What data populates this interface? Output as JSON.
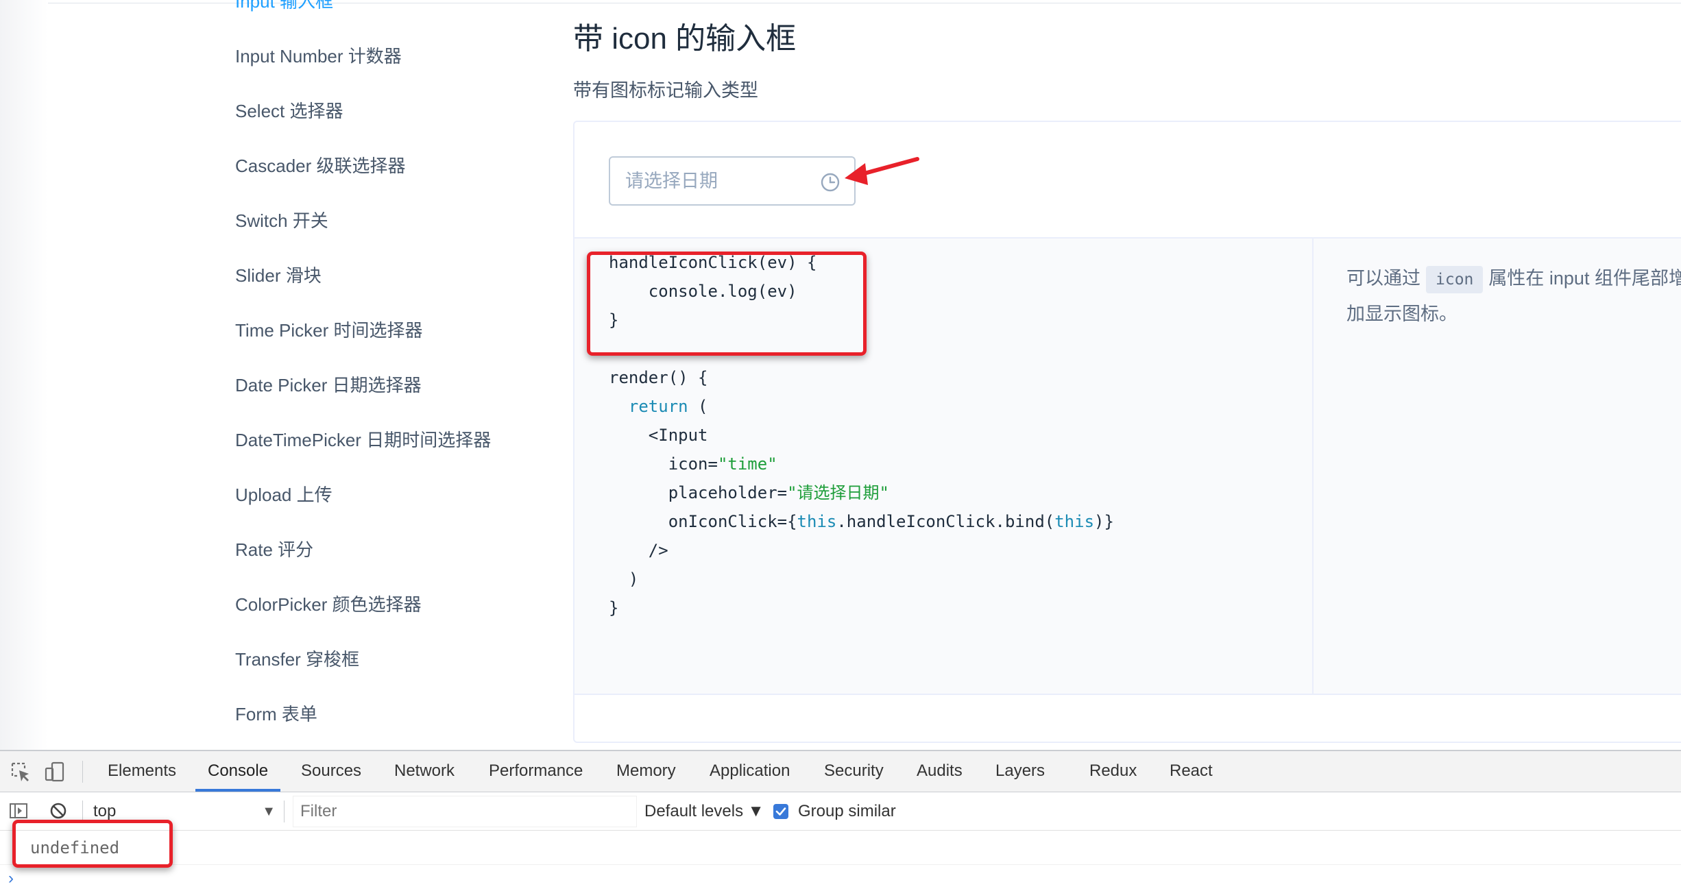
{
  "sidebar": {
    "items": [
      {
        "label": "Input 输入框",
        "active": true
      },
      {
        "label": "Input Number 计数器"
      },
      {
        "label": "Select 选择器"
      },
      {
        "label": "Cascader 级联选择器"
      },
      {
        "label": "Switch 开关"
      },
      {
        "label": "Slider 滑块"
      },
      {
        "label": "Time Picker 时间选择器"
      },
      {
        "label": "Date Picker 日期选择器"
      },
      {
        "label": "DateTimePicker 日期时间选择器"
      },
      {
        "label": "Upload 上传"
      },
      {
        "label": "Rate 评分"
      },
      {
        "label": "ColorPicker 颜色选择器"
      },
      {
        "label": "Transfer 穿梭框"
      },
      {
        "label": "Form 表单"
      }
    ]
  },
  "main": {
    "title": "带 icon 的输入框",
    "description": "带有图标标记输入类型",
    "demo": {
      "input_placeholder": "请选择日期",
      "input_icon": "clock-icon"
    },
    "code_lines": [
      [
        [
          "plain",
          "handleIconClick(ev) {"
        ]
      ],
      [
        [
          "plain",
          "    console.log(ev)"
        ]
      ],
      [
        [
          "plain",
          "}"
        ]
      ],
      [
        [
          "plain",
          ""
        ]
      ],
      [
        [
          "plain",
          "render() {"
        ]
      ],
      [
        [
          "plain",
          "  "
        ],
        [
          "kw",
          "return"
        ],
        [
          "plain",
          " ("
        ]
      ],
      [
        [
          "plain",
          "    <Input"
        ]
      ],
      [
        [
          "plain",
          "      icon="
        ],
        [
          "str",
          "\"time\""
        ]
      ],
      [
        [
          "plain",
          "      placeholder="
        ],
        [
          "str",
          "\"请选择日期\""
        ]
      ],
      [
        [
          "plain",
          "      onIconClick={"
        ],
        [
          "kw",
          "this"
        ],
        [
          "plain",
          ".handleIconClick.bind("
        ],
        [
          "kw",
          "this"
        ],
        [
          "plain",
          ")}"
        ]
      ],
      [
        [
          "plain",
          "    />"
        ]
      ],
      [
        [
          "plain",
          "  )"
        ]
      ],
      [
        [
          "plain",
          "}"
        ]
      ]
    ],
    "attribute_note": {
      "prefix": "可以通过",
      "code": "icon",
      "suffix": "属性在 input 组件尾部增加显示图标。"
    }
  },
  "devtools": {
    "tool_icons": [
      "inspect-element-icon",
      "device-toolbar-icon"
    ],
    "tabs": [
      "Elements",
      "Console",
      "Sources",
      "Network",
      "Performance",
      "Memory",
      "Application",
      "Security",
      "Audits",
      "Layers",
      "Redux",
      "React"
    ],
    "active_tab": "Console",
    "console_toolbar": {
      "sidebar_icon": "show-console-sidebar-icon",
      "clear_icon": "clear-console-icon",
      "context": "top",
      "filter_placeholder": "Filter",
      "levels": "Default levels ▼",
      "group_similar": "Group similar",
      "group_similar_checked": true
    },
    "console_output": [
      "undefined"
    ],
    "prompt": "›"
  },
  "colors": {
    "accent": "#20a0ff",
    "annotation_red": "#e8212a",
    "devtools_active": "#3879d9"
  }
}
